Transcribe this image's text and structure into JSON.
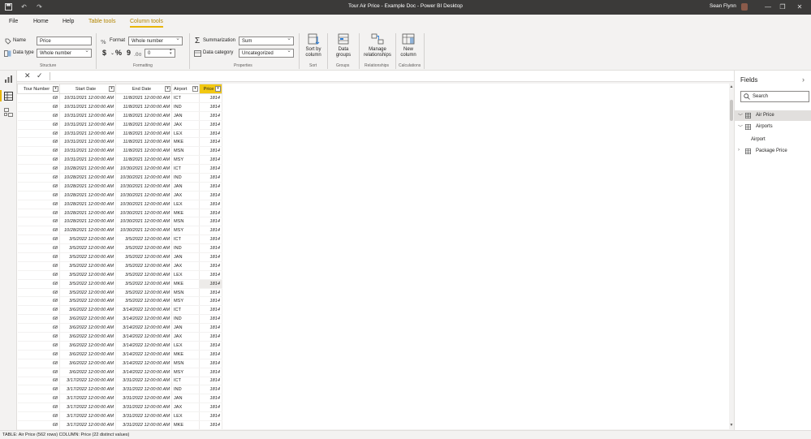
{
  "window": {
    "title": "Tour Air Price - Example Doc - Power BI Desktop",
    "user": "Sean Flynn",
    "minimize": "—",
    "restore": "❐",
    "close": "✕"
  },
  "ribbon_tabs": [
    "File",
    "Home",
    "Help",
    "Table tools",
    "Column tools"
  ],
  "ribbon": {
    "structure": {
      "name_label": "Name",
      "name_value": "Price",
      "datatype_label": "Data type",
      "datatype_value": "Whole number",
      "group": "Structure"
    },
    "formatting": {
      "format_label": "Format",
      "format_value": "Whole number",
      "currency": "$",
      "percent": "%",
      "comma": "9",
      "decimals_value": "0",
      "group": "Formatting"
    },
    "properties": {
      "summarization_label": "Summarization",
      "summarization_value": "Sum",
      "category_label": "Data category",
      "category_value": "Uncategorized",
      "group": "Properties"
    },
    "sort": {
      "label1": "Sort by",
      "label2": "column",
      "group": "Sort"
    },
    "groups": {
      "label1": "Data",
      "label2": "groups",
      "group": "Groups"
    },
    "relationships": {
      "label1": "Manage",
      "label2": "relationships",
      "group": "Relationships"
    },
    "calculations": {
      "label1": "New",
      "label2": "column",
      "group": "Calculations"
    }
  },
  "table": {
    "columns": [
      "Tour Number",
      "Start Date",
      "End Date",
      "Airport",
      "Price"
    ],
    "selected_column": "Price",
    "highlighted_row": 21,
    "rows": [
      [
        "68",
        "10/31/2021 12:00:00 AM",
        "11/8/2021 12:00:00 AM",
        "ICT",
        "1814"
      ],
      [
        "68",
        "10/31/2021 12:00:00 AM",
        "11/8/2021 12:00:00 AM",
        "IND",
        "1814"
      ],
      [
        "68",
        "10/31/2021 12:00:00 AM",
        "11/8/2021 12:00:00 AM",
        "JAN",
        "1814"
      ],
      [
        "68",
        "10/31/2021 12:00:00 AM",
        "11/8/2021 12:00:00 AM",
        "JAX",
        "1814"
      ],
      [
        "68",
        "10/31/2021 12:00:00 AM",
        "11/8/2021 12:00:00 AM",
        "LEX",
        "1814"
      ],
      [
        "68",
        "10/31/2021 12:00:00 AM",
        "11/8/2021 12:00:00 AM",
        "MKE",
        "1814"
      ],
      [
        "68",
        "10/31/2021 12:00:00 AM",
        "11/8/2021 12:00:00 AM",
        "MSN",
        "1814"
      ],
      [
        "68",
        "10/31/2021 12:00:00 AM",
        "11/8/2021 12:00:00 AM",
        "MSY",
        "1814"
      ],
      [
        "68",
        "10/28/2021 12:00:00 AM",
        "10/30/2021 12:00:00 AM",
        "ICT",
        "1814"
      ],
      [
        "68",
        "10/28/2021 12:00:00 AM",
        "10/30/2021 12:00:00 AM",
        "IND",
        "1814"
      ],
      [
        "68",
        "10/28/2021 12:00:00 AM",
        "10/30/2021 12:00:00 AM",
        "JAN",
        "1814"
      ],
      [
        "68",
        "10/28/2021 12:00:00 AM",
        "10/30/2021 12:00:00 AM",
        "JAX",
        "1814"
      ],
      [
        "68",
        "10/28/2021 12:00:00 AM",
        "10/30/2021 12:00:00 AM",
        "LEX",
        "1814"
      ],
      [
        "68",
        "10/28/2021 12:00:00 AM",
        "10/30/2021 12:00:00 AM",
        "MKE",
        "1814"
      ],
      [
        "68",
        "10/28/2021 12:00:00 AM",
        "10/30/2021 12:00:00 AM",
        "MSN",
        "1814"
      ],
      [
        "68",
        "10/28/2021 12:00:00 AM",
        "10/30/2021 12:00:00 AM",
        "MSY",
        "1814"
      ],
      [
        "68",
        "3/5/2022 12:00:00 AM",
        "3/5/2022 12:00:00 AM",
        "ICT",
        "1814"
      ],
      [
        "68",
        "3/5/2022 12:00:00 AM",
        "3/5/2022 12:00:00 AM",
        "IND",
        "1814"
      ],
      [
        "68",
        "3/5/2022 12:00:00 AM",
        "3/5/2022 12:00:00 AM",
        "JAN",
        "1814"
      ],
      [
        "68",
        "3/5/2022 12:00:00 AM",
        "3/5/2022 12:00:00 AM",
        "JAX",
        "1814"
      ],
      [
        "68",
        "3/5/2022 12:00:00 AM",
        "3/5/2022 12:00:00 AM",
        "LEX",
        "1814"
      ],
      [
        "68",
        "3/5/2022 12:00:00 AM",
        "3/5/2022 12:00:00 AM",
        "MKE",
        "1814"
      ],
      [
        "68",
        "3/5/2022 12:00:00 AM",
        "3/5/2022 12:00:00 AM",
        "MSN",
        "1814"
      ],
      [
        "68",
        "3/5/2022 12:00:00 AM",
        "3/5/2022 12:00:00 AM",
        "MSY",
        "1814"
      ],
      [
        "68",
        "3/6/2022 12:00:00 AM",
        "3/14/2022 12:00:00 AM",
        "ICT",
        "1814"
      ],
      [
        "68",
        "3/6/2022 12:00:00 AM",
        "3/14/2022 12:00:00 AM",
        "IND",
        "1814"
      ],
      [
        "68",
        "3/6/2022 12:00:00 AM",
        "3/14/2022 12:00:00 AM",
        "JAN",
        "1814"
      ],
      [
        "68",
        "3/6/2022 12:00:00 AM",
        "3/14/2022 12:00:00 AM",
        "JAX",
        "1814"
      ],
      [
        "68",
        "3/6/2022 12:00:00 AM",
        "3/14/2022 12:00:00 AM",
        "LEX",
        "1814"
      ],
      [
        "68",
        "3/6/2022 12:00:00 AM",
        "3/14/2022 12:00:00 AM",
        "MKE",
        "1814"
      ],
      [
        "68",
        "3/6/2022 12:00:00 AM",
        "3/14/2022 12:00:00 AM",
        "MSN",
        "1814"
      ],
      [
        "68",
        "3/6/2022 12:00:00 AM",
        "3/14/2022 12:00:00 AM",
        "MSY",
        "1814"
      ],
      [
        "68",
        "3/17/2022 12:00:00 AM",
        "3/31/2022 12:00:00 AM",
        "ICT",
        "1814"
      ],
      [
        "68",
        "3/17/2022 12:00:00 AM",
        "3/31/2022 12:00:00 AM",
        "IND",
        "1814"
      ],
      [
        "68",
        "3/17/2022 12:00:00 AM",
        "3/31/2022 12:00:00 AM",
        "JAN",
        "1814"
      ],
      [
        "68",
        "3/17/2022 12:00:00 AM",
        "3/31/2022 12:00:00 AM",
        "JAX",
        "1814"
      ],
      [
        "68",
        "3/17/2022 12:00:00 AM",
        "3/31/2022 12:00:00 AM",
        "LEX",
        "1814"
      ],
      [
        "68",
        "3/17/2022 12:00:00 AM",
        "3/31/2022 12:00:00 AM",
        "MKE",
        "1814"
      ]
    ]
  },
  "fields": {
    "title": "Fields",
    "search_placeholder": "Search",
    "tables": [
      {
        "name": "Air Price",
        "expanded": true,
        "selected": true
      },
      {
        "name": "Airports",
        "expanded": true,
        "selected": false,
        "children": [
          "Airport"
        ]
      },
      {
        "name": "Package Price",
        "expanded": false,
        "selected": false
      }
    ]
  },
  "status": "TABLE: Air Price (562 rows) COLUMN: Price (22 distinct values)",
  "colors": {
    "accent": "#f2c811",
    "titlebar": "#3b3a39",
    "context_tab": "#b38600"
  }
}
